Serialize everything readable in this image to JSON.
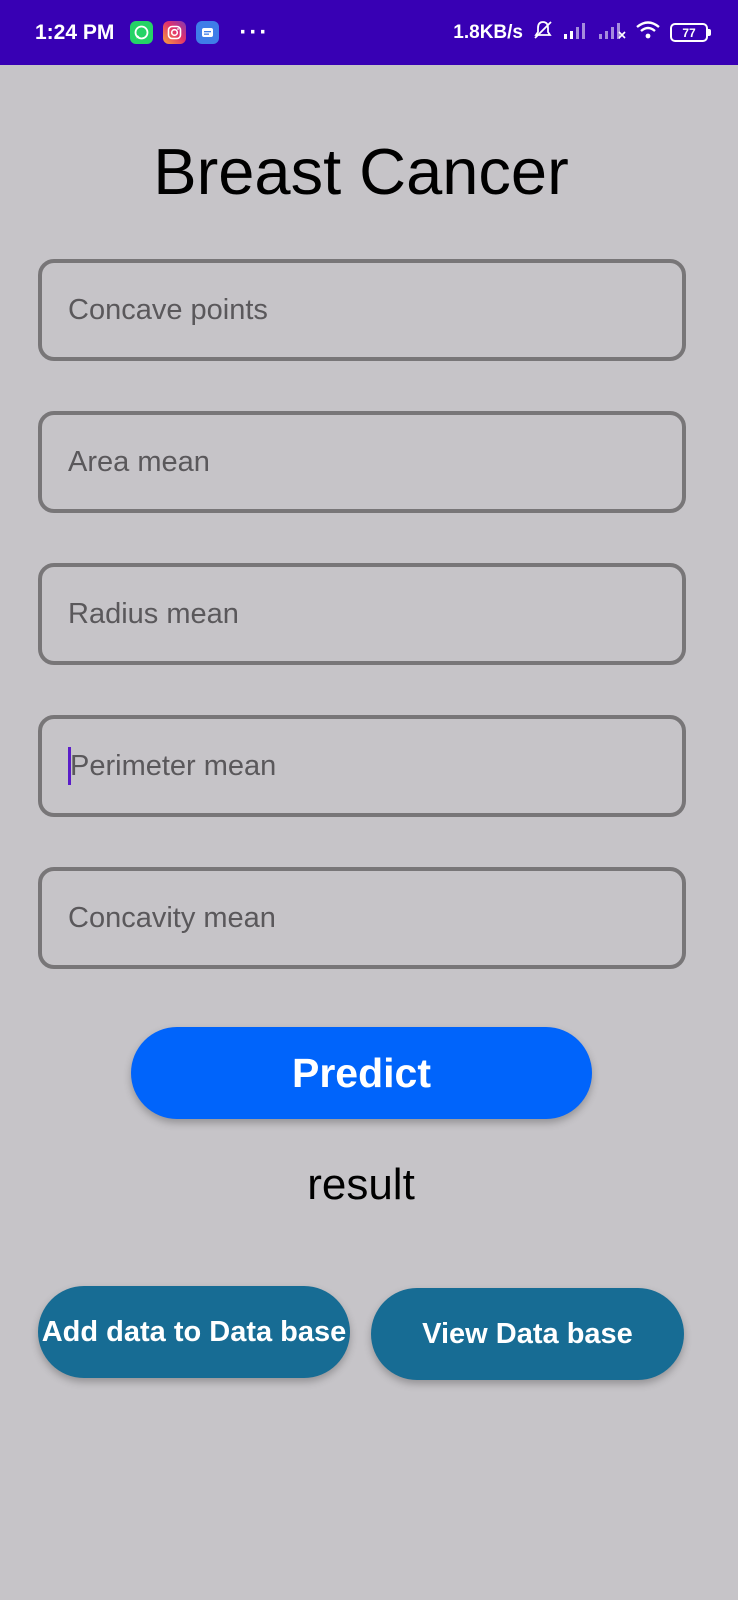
{
  "status_bar": {
    "time": "1:24 PM",
    "net_speed": "1.8KB/s",
    "battery": "77",
    "more": "···",
    "icons": [
      "whatsapp-icon",
      "instagram-icon",
      "messages-icon",
      "silent-bell-icon",
      "signal-icon",
      "signal-x-icon",
      "wifi-icon",
      "battery-icon"
    ]
  },
  "title": "Breast Cancer",
  "fields": [
    {
      "placeholder": "Concave points",
      "value": ""
    },
    {
      "placeholder": "Area mean",
      "value": ""
    },
    {
      "placeholder": "Radius mean",
      "value": ""
    },
    {
      "placeholder": "Perimeter mean",
      "value": "",
      "focused": true
    },
    {
      "placeholder": "Concavity mean",
      "value": ""
    }
  ],
  "predict_label": "Predict",
  "result_label": "result",
  "add_db_label": "Add data to Data base",
  "view_db_label": "View Data base",
  "colors": {
    "status_bar": "#3800b4",
    "background": "#c6c4c8",
    "predict_button": "#0064fb",
    "db_buttons": "#176c94",
    "cursor": "#5a1cc9"
  }
}
